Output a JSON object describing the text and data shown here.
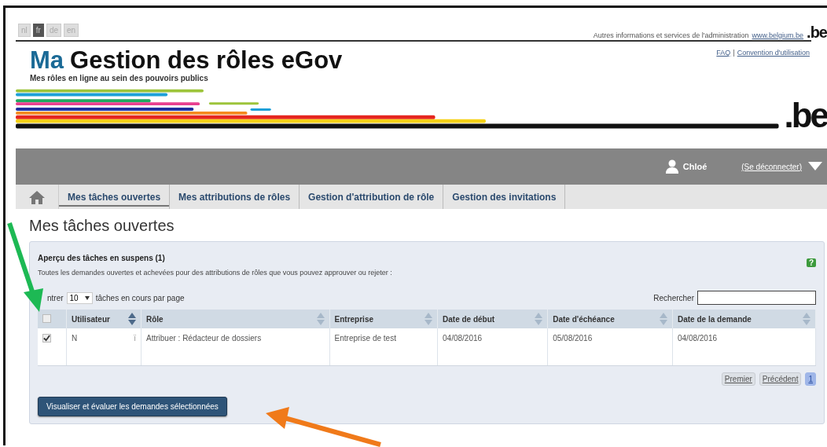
{
  "languages": [
    {
      "label": "nl",
      "selected": false
    },
    {
      "label": "fr",
      "selected": true
    },
    {
      "label": "de",
      "selected": false
    },
    {
      "label": "en",
      "selected": false
    }
  ],
  "top_links": {
    "info": "Autres informations et services de l'administration",
    "site_link": "www.belgium.be",
    "logo_small": ".be",
    "faq": "FAQ",
    "separator": "|",
    "terms": "Convention d'utilisation"
  },
  "header": {
    "title_accent": "Ma",
    "title": "Gestion des rôles eGov",
    "subtitle": "Mes rôles en ligne au sein des pouvoirs publics",
    "logo": ".be"
  },
  "user_bar": {
    "user": "Chloé",
    "logout": "(Se déconnecter)"
  },
  "tabs": [
    {
      "label": "Mes tâches ouvertes",
      "selected": true
    },
    {
      "label": "Mes attributions de rôles",
      "selected": false
    },
    {
      "label": "Gestion d'attribution de rôle",
      "selected": false
    },
    {
      "label": "Gestion des invitations",
      "selected": false
    }
  ],
  "page_title": "Mes tâches ouvertes",
  "panel": {
    "title": "Aperçu des tâches en suspens (1)",
    "description": "Toutes les demandes ouvertes et achevées pour des attributions de rôles que vous pouvez approuver ou rejeter :",
    "help": "?",
    "show_prefix": "ntrer",
    "page_size": "10",
    "show_suffix": "tâches en cours par page",
    "search_label": "Rechercher",
    "table": {
      "select_all_checked": false,
      "columns": [
        {
          "label": "Utilisateur",
          "sorted": true
        },
        {
          "label": "Rôle",
          "sorted": false
        },
        {
          "label": "Entreprise",
          "sorted": false
        },
        {
          "label": "Date de début",
          "sorted": false
        },
        {
          "label": "Date d'échéance",
          "sorted": false
        },
        {
          "label": "Date de la demande",
          "sorted": false
        }
      ],
      "rows": [
        {
          "checked": true,
          "cells": [
            "N",
            "Attribuer : Rédacteur de dossiers",
            "Entreprise de test",
            "04/08/2016",
            "05/08/2016",
            "04/08/2016"
          ],
          "user_mark": "ï"
        }
      ]
    },
    "pagination": [
      {
        "label": "Premier",
        "selected": false
      },
      {
        "label": "Précédent",
        "selected": false
      },
      {
        "label": "1",
        "selected": true
      }
    ],
    "action_button": "Visualiser et évaluer les demandes sélectionnées"
  }
}
